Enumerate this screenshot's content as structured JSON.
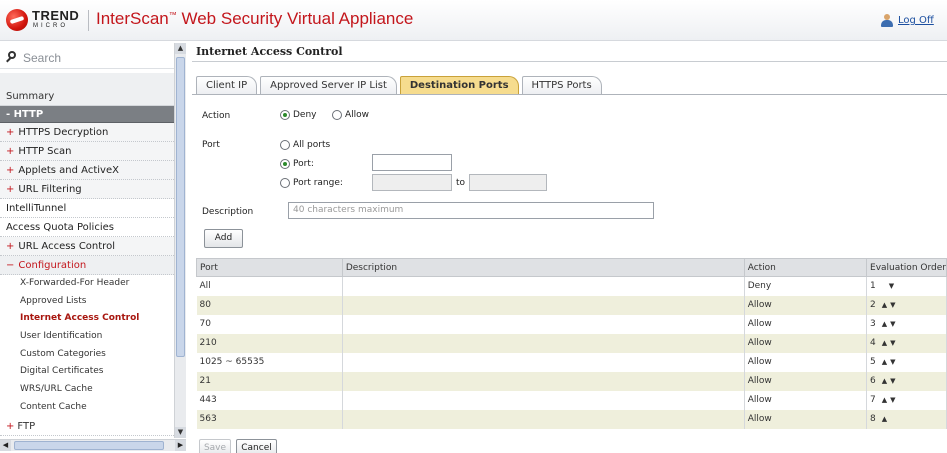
{
  "header": {
    "logo_word": "TREND",
    "logo_sub": "MICRO",
    "app_title": "InterScan",
    "app_title_tm": "™",
    "app_title_rest": " Web Security Virtual Appliance",
    "logoff_label": "Log Off"
  },
  "sidebar": {
    "search_placeholder": "Search",
    "summary": "Summary",
    "section": "HTTP",
    "items": [
      {
        "prefix": "+",
        "label": "HTTPS Decryption",
        "kind": "group"
      },
      {
        "prefix": "+",
        "label": "HTTP Scan",
        "kind": "group"
      },
      {
        "prefix": "+",
        "label": "Applets and ActiveX",
        "kind": "group"
      },
      {
        "prefix": "+",
        "label": "URL Filtering",
        "kind": "group"
      },
      {
        "prefix": "",
        "label": "IntelliTunnel",
        "kind": "plain"
      },
      {
        "prefix": "",
        "label": "Access Quota Policies",
        "kind": "plain"
      },
      {
        "prefix": "+",
        "label": "URL Access Control",
        "kind": "group"
      },
      {
        "prefix": "−",
        "label": "Configuration",
        "kind": "open"
      }
    ],
    "sub_items": [
      "X-Forwarded-For Header",
      "Approved Lists",
      "Internet Access Control",
      "User Identification",
      "Custom Categories",
      "Digital Certificates",
      "WRS/URL Cache",
      "Content Cache"
    ],
    "active_sub_index": 2,
    "ftp": {
      "prefix": "+",
      "label": "FTP"
    }
  },
  "main": {
    "title": "Internet Access Control",
    "tabs": [
      "Client IP",
      "Approved Server IP List",
      "Destination Ports",
      "HTTPS Ports"
    ],
    "active_tab_index": 2,
    "form": {
      "action_label": "Action",
      "action_options": [
        "Deny",
        "Allow"
      ],
      "action_selected": "Deny",
      "port_label": "Port",
      "port_all": "All ports",
      "port_single": "Port:",
      "port_range": "Port range:",
      "port_range_to": "to",
      "port_selected": "Port:",
      "port_value": "",
      "description_label": "Description",
      "description_placeholder": "40 characters maximum",
      "add_label": "Add"
    },
    "table": {
      "headers": [
        "Port",
        "Description",
        "Action",
        "Evaluation Order"
      ],
      "rows": [
        {
          "port": "All",
          "description": "",
          "action": "Deny",
          "order": "1",
          "up": false,
          "down": true
        },
        {
          "port": "80",
          "description": "",
          "action": "Allow",
          "order": "2",
          "up": true,
          "down": true
        },
        {
          "port": "70",
          "description": "",
          "action": "Allow",
          "order": "3",
          "up": true,
          "down": true
        },
        {
          "port": "210",
          "description": "",
          "action": "Allow",
          "order": "4",
          "up": true,
          "down": true
        },
        {
          "port": "1025 ~ 65535",
          "description": "",
          "action": "Allow",
          "order": "5",
          "up": true,
          "down": true
        },
        {
          "port": "21",
          "description": "",
          "action": "Allow",
          "order": "6",
          "up": true,
          "down": true
        },
        {
          "port": "443",
          "description": "",
          "action": "Allow",
          "order": "7",
          "up": true,
          "down": true
        },
        {
          "port": "563",
          "description": "",
          "action": "Allow",
          "order": "8",
          "up": true,
          "down": false
        }
      ]
    },
    "save_label": "Save",
    "cancel_label": "Cancel"
  },
  "colors": {
    "brand_red": "#c3161c",
    "active_tab": "#f6dc8e",
    "section_header": "#7b7f84",
    "radio_selected": "#2c8a2c"
  }
}
